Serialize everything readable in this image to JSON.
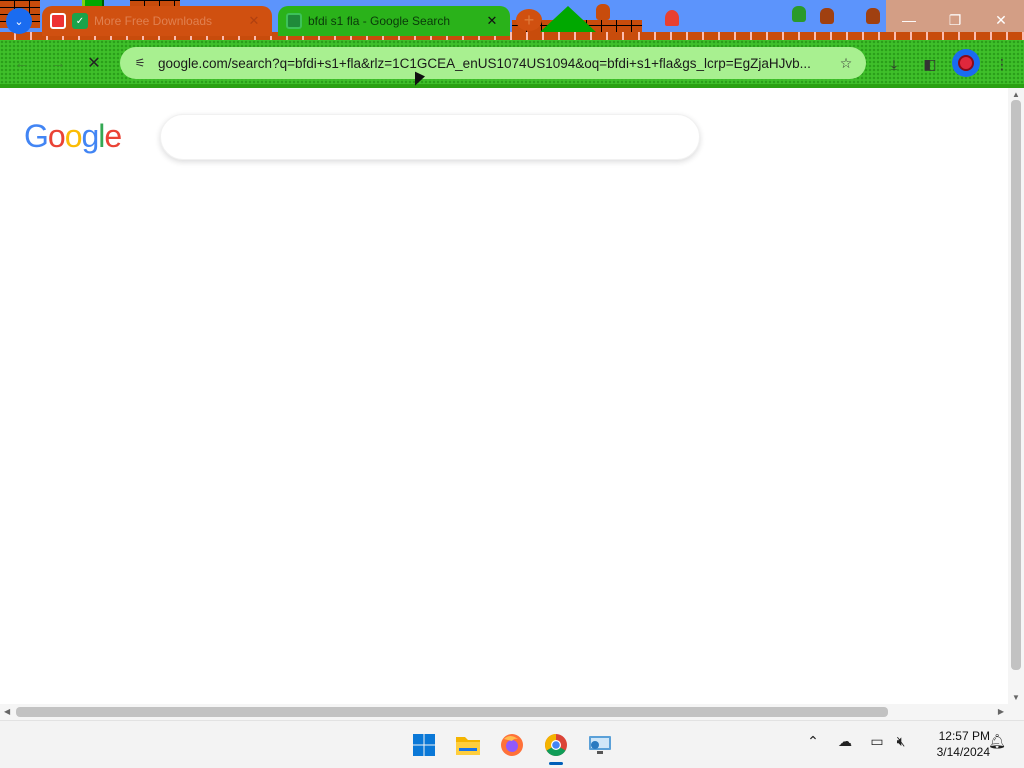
{
  "browser": {
    "tabs": [
      {
        "title": "More Free Downloads",
        "active": false
      },
      {
        "title": "bfdi s1 fla - Google Search",
        "active": true
      }
    ],
    "address": "google.com/search?q=bfdi+s1+fla&rlz=1C1GCEA_enUS1074US1094&oq=bfdi+s1+fla&gs_lcrp=EgZjaHJvb...",
    "window_controls": {
      "minimize": "—",
      "restore": "❐",
      "close": "✕"
    }
  },
  "page": {
    "logo": {
      "G": "G",
      "o1": "o",
      "o2": "o",
      "g": "g",
      "l": "l",
      "e": "e"
    }
  },
  "taskbar": {
    "time": "12:57 PM",
    "date": "3/14/2024"
  },
  "colors": {
    "accent": "#1a6cf0",
    "active_tab": "#2ab21a",
    "inactive_tab": "#d05010",
    "toolbar": "#3fc02a"
  }
}
